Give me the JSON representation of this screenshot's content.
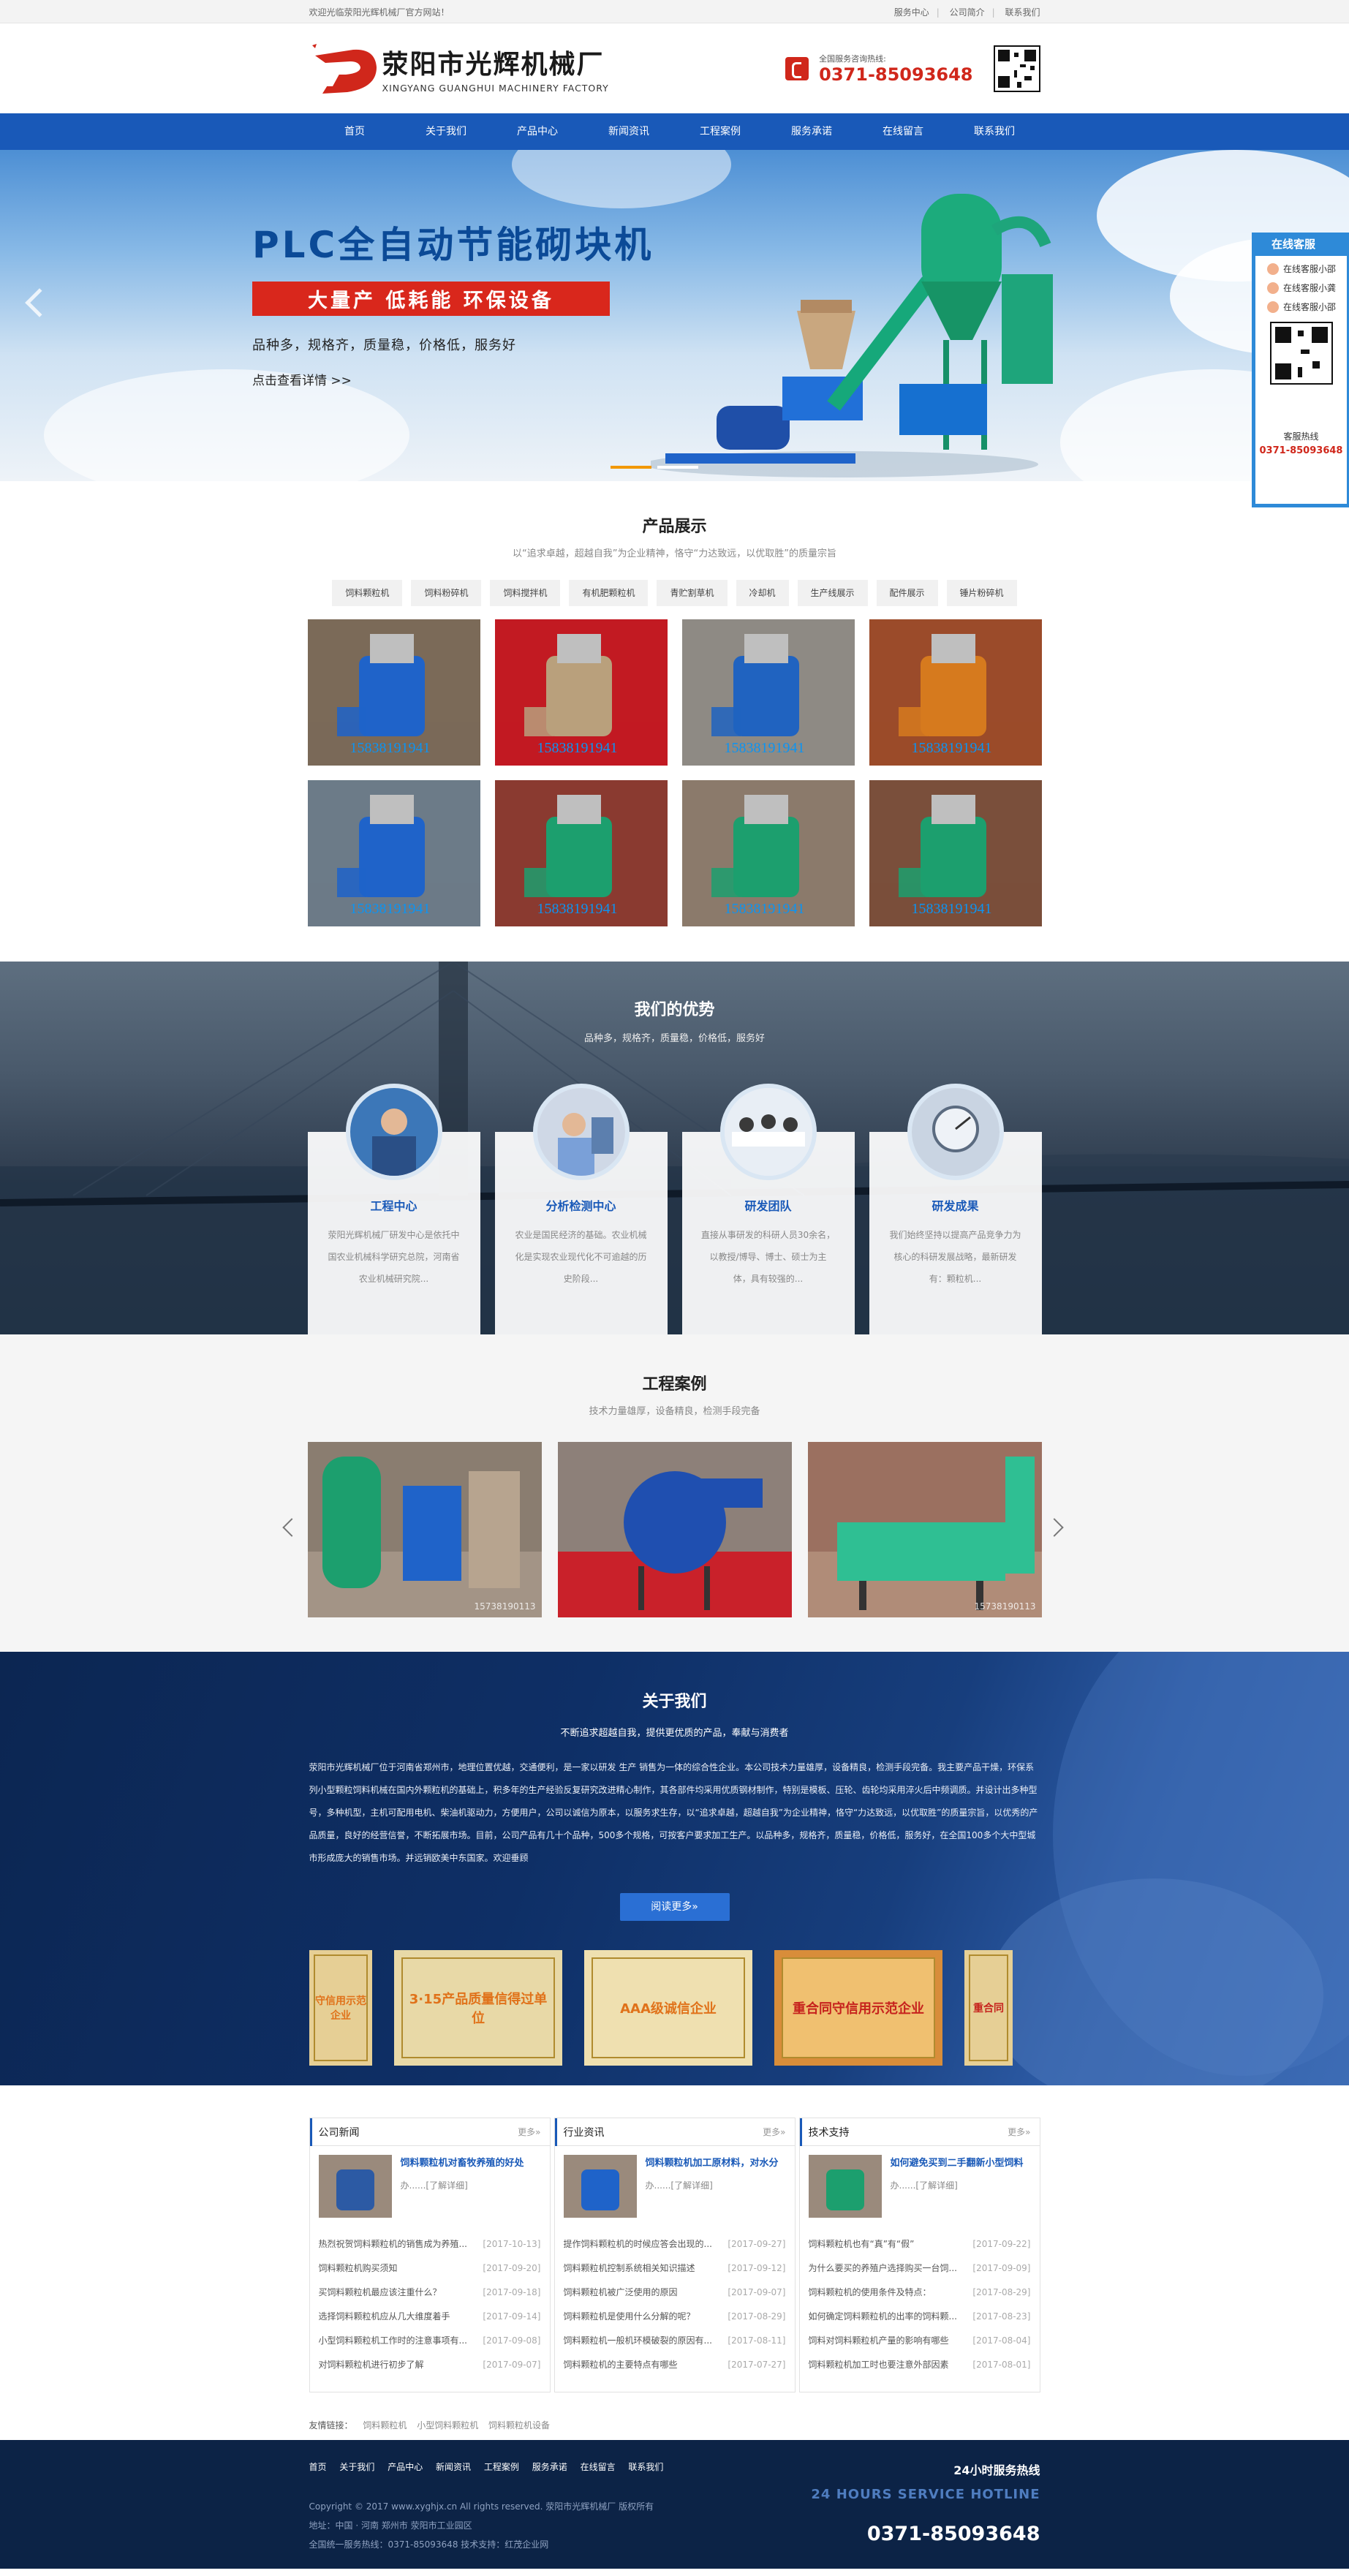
{
  "topbar": {
    "welcome": "欢迎光临荥阳光辉机械厂官方网站！",
    "links": [
      "服务中心",
      "公司简介",
      "联系我们"
    ]
  },
  "header": {
    "logo_cn": "荥阳市光辉机械厂",
    "logo_en": "XINGYANG GUANGHUI MACHINERY FACTORY",
    "hotline_label": "全国服务咨询热线:",
    "hotline": "0371-85093648"
  },
  "nav": [
    "首页",
    "关于我们",
    "产品中心",
    "新闻资讯",
    "工程案例",
    "服务承诺",
    "在线留言",
    "联系我们"
  ],
  "banner": {
    "title": "PLC全自动节能砌块机",
    "slogan": "大量产 低耗能 环保设备",
    "sub": "品种多，规格齐，质量稳，价格低，服务好",
    "more": "点击查看详情 >>",
    "active_slide": 1,
    "slide_count": 2
  },
  "kefu": {
    "title": "在线客服",
    "items": [
      "在线客服小邵",
      "在线客服小龚",
      "在线客服小邵"
    ],
    "line_label": "客服热线",
    "line_num": "0371-85093648"
  },
  "products": {
    "title": "产品展示",
    "subtitle": "以“追求卓越，超越自我”为企业精神，恪守“力达致远，以优取胜”的质量宗旨",
    "tabs": [
      "饲料颗粒机",
      "饲料粉碎机",
      "饲料搅拌机",
      "有机肥颗粒机",
      "青贮割草机",
      "冷却机",
      "生产线展示",
      "配件展示",
      "锤片粉碎机"
    ],
    "phone_watermark": "15838191941",
    "items": [
      {
        "bg": "#7b6a58",
        "machine": "#1f63c9"
      },
      {
        "bg": "#c21a22",
        "machine": "#b9a07c"
      },
      {
        "bg": "#8e8a84",
        "machine": "#2063c0"
      },
      {
        "bg": "#9b4b2a",
        "machine": "#d67a1e"
      },
      {
        "bg": "#6c7b88",
        "machine": "#1f63c9"
      },
      {
        "bg": "#8a3a30",
        "machine": "#1c9f6e"
      },
      {
        "bg": "#8b7a6b",
        "machine": "#1c9f6e"
      },
      {
        "bg": "#7a4f3b",
        "machine": "#1c9f6e"
      }
    ]
  },
  "advantages": {
    "title": "我们的优势",
    "subtitle": "品种多，规格齐，质量稳，价格低，服务好",
    "cards": [
      {
        "title": "工程中心",
        "desc": "荥阳光辉机械厂研发中心是依托中国农业机械科学研究总院，河南省农业机械研究院..."
      },
      {
        "title": "分析检测中心",
        "desc": "农业是国民经济的基础。农业机械化是实现农业现代化不可逾越的历史阶段..."
      },
      {
        "title": "研发团队",
        "desc": "直接从事研发的科研人员30余名，以教授/博导、博士、硕士为主体，具有较强的..."
      },
      {
        "title": "研发成果",
        "desc": "我们始终坚持以提高产品竞争力为核心的科研发展战略，最新研发有：颗粒机..."
      }
    ]
  },
  "cases": {
    "title": "工程案例",
    "subtitle": "技术力量雄厚，设备精良，检测手段完备",
    "watermarks": [
      "15738190113",
      "",
      "15738190113"
    ]
  },
  "about": {
    "title": "关于我们",
    "subtitle": "不断追求超越自我，提供更优质的产品，奉献与消费者",
    "text": "荥阳市光辉机械厂位于河南省郑州市，地理位置优越，交通便利，是一家以研发 生产 销售为一体的综合性企业。本公司技术力量雄厚，设备精良，检测手段完备。我主要产品干燥，环保系列小型颗粒饲料机械在国内外颗粒机的基础上，积多年的生产经验反复研究改进精心制作，其各部件均采用优质钢材制作，特别是模板、压轮、齿轮均采用淬火后中频调质。并设计出多种型号，多种机型，主机可配用电机、柴油机驱动力，方便用户，公司以诚信为原本，以服务求生存，以“追求卓越，超越自我”为企业精神，恪守“力达致远，以优取胜”的质量宗旨，以优秀的产品质量，良好的经营信誉，不断拓展市场。目前，公司产品有几十个品种，500多个规格，可按客户要求加工生产。以品种多，规格齐，质量稳，价格低，服务好，在全国100多个大中型城市形成庞大的销售市场。并远销欧美中东国家。欢迎垂顾",
    "button": "阅读更多»",
    "certs": [
      "守信用示范企业",
      "3·15产品质量信得过单位",
      "AAA级诚信企业",
      "重合同守信用示范企业",
      "重合同"
    ]
  },
  "news": {
    "more": "更多»",
    "more_link": "[了解详细]",
    "cols": [
      {
        "title": "公司新闻",
        "feat_title": "饲料颗粒机对畜牧养殖的好处",
        "feat_desc": "办......",
        "items": [
          {
            "t": "热烈祝贺饲料颗粒机的销售成为养殖...",
            "d": "[2017-10-13]"
          },
          {
            "t": "饲料颗粒机购买须知",
            "d": "[2017-09-20]"
          },
          {
            "t": "买饲料颗粒机最应该注重什么？",
            "d": "[2017-09-18]"
          },
          {
            "t": "选择饲料颗粒机应从几大维度着手",
            "d": "[2017-09-14]"
          },
          {
            "t": "小型饲料颗粒机工作时的注意事项有...",
            "d": "[2017-09-08]"
          },
          {
            "t": "对饲料颗粒机进行初步了解",
            "d": "[2017-09-07]"
          }
        ]
      },
      {
        "title": "行业资讯",
        "feat_title": "饲料颗粒机加工原材料，对水分",
        "feat_desc": "办......",
        "items": [
          {
            "t": "提作饲料颗粒机的时候应答会出现的...",
            "d": "[2017-09-27]"
          },
          {
            "t": "饲料颗粒机控制系统相关知识描述",
            "d": "[2017-09-12]"
          },
          {
            "t": "饲料颗粒机被广泛使用的原因",
            "d": "[2017-09-07]"
          },
          {
            "t": "饲料颗粒机是使用什么分解的呢？",
            "d": "[2017-08-29]"
          },
          {
            "t": "饲料颗粒机一般机环模破裂的原因有...",
            "d": "[2017-08-11]"
          },
          {
            "t": "饲料颗粒机的主要特点有哪些",
            "d": "[2017-07-27]"
          }
        ]
      },
      {
        "title": "技术支持",
        "feat_title": "如何避免买到二手翻新小型饲料",
        "feat_desc": "办......",
        "items": [
          {
            "t": "饲料颗粒机也有“真”有“假”",
            "d": "[2017-09-22]"
          },
          {
            "t": "为什么要买的养殖户选择购买一台饲...",
            "d": "[2017-09-09]"
          },
          {
            "t": "饲料颗粒机的使用条件及特点：",
            "d": "[2017-08-29]"
          },
          {
            "t": "如何确定饲料颗粒机的出率的饲料颗...",
            "d": "[2017-08-23]"
          },
          {
            "t": "饲料对饲料颗粒机产量的影响有哪些",
            "d": "[2017-08-04]"
          },
          {
            "t": "饲料颗粒机加工时也要注意外部因素",
            "d": "[2017-08-01]"
          }
        ]
      }
    ]
  },
  "friend_links": {
    "label": "友情链接：",
    "items": [
      "饲料颗粒机",
      "小型饲料颗粒机",
      "饲料颗粒机设备"
    ]
  },
  "footer": {
    "nav": [
      "首页",
      "关于我们",
      "产品中心",
      "新闻资讯",
      "工程案例",
      "服务承诺",
      "在线留言",
      "联系我们"
    ],
    "copyright": "Copyright © 2017 www.xyghjx.cn All rights reserved. 荥阳市光辉机械厂 版权所有",
    "address": "地址：中国 · 河南 郑州市 荥阳市工业园区",
    "tel": "全国统一服务热线：0371-85093648 技术支持：红茂企业网",
    "hot_title": "24小时服务热线",
    "hot_en": "24 HOURS SERVICE HOTLINE",
    "hot_num": "0371-85093648"
  },
  "colors": {
    "brand_blue": "#1959b8",
    "brand_red": "#d0271b",
    "footer_bg": "#0c2346"
  }
}
